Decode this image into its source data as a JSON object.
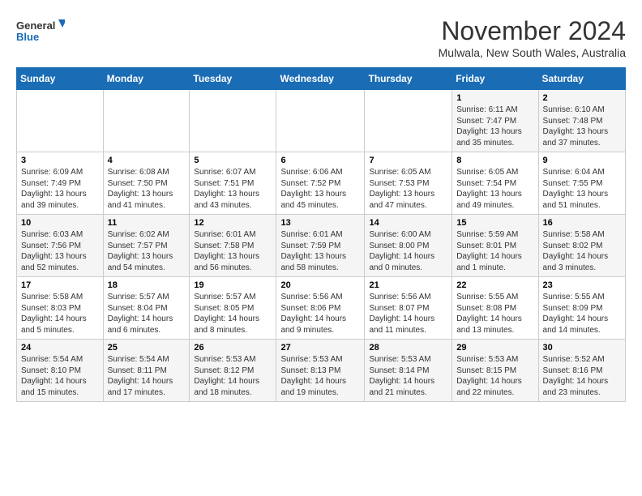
{
  "header": {
    "logo_line1": "General",
    "logo_line2": "Blue",
    "month_title": "November 2024",
    "location": "Mulwala, New South Wales, Australia"
  },
  "days_of_week": [
    "Sunday",
    "Monday",
    "Tuesday",
    "Wednesday",
    "Thursday",
    "Friday",
    "Saturday"
  ],
  "weeks": [
    [
      {
        "day": "",
        "content": ""
      },
      {
        "day": "",
        "content": ""
      },
      {
        "day": "",
        "content": ""
      },
      {
        "day": "",
        "content": ""
      },
      {
        "day": "",
        "content": ""
      },
      {
        "day": "1",
        "content": "Sunrise: 6:11 AM\nSunset: 7:47 PM\nDaylight: 13 hours\nand 35 minutes."
      },
      {
        "day": "2",
        "content": "Sunrise: 6:10 AM\nSunset: 7:48 PM\nDaylight: 13 hours\nand 37 minutes."
      }
    ],
    [
      {
        "day": "3",
        "content": "Sunrise: 6:09 AM\nSunset: 7:49 PM\nDaylight: 13 hours\nand 39 minutes."
      },
      {
        "day": "4",
        "content": "Sunrise: 6:08 AM\nSunset: 7:50 PM\nDaylight: 13 hours\nand 41 minutes."
      },
      {
        "day": "5",
        "content": "Sunrise: 6:07 AM\nSunset: 7:51 PM\nDaylight: 13 hours\nand 43 minutes."
      },
      {
        "day": "6",
        "content": "Sunrise: 6:06 AM\nSunset: 7:52 PM\nDaylight: 13 hours\nand 45 minutes."
      },
      {
        "day": "7",
        "content": "Sunrise: 6:05 AM\nSunset: 7:53 PM\nDaylight: 13 hours\nand 47 minutes."
      },
      {
        "day": "8",
        "content": "Sunrise: 6:05 AM\nSunset: 7:54 PM\nDaylight: 13 hours\nand 49 minutes."
      },
      {
        "day": "9",
        "content": "Sunrise: 6:04 AM\nSunset: 7:55 PM\nDaylight: 13 hours\nand 51 minutes."
      }
    ],
    [
      {
        "day": "10",
        "content": "Sunrise: 6:03 AM\nSunset: 7:56 PM\nDaylight: 13 hours\nand 52 minutes."
      },
      {
        "day": "11",
        "content": "Sunrise: 6:02 AM\nSunset: 7:57 PM\nDaylight: 13 hours\nand 54 minutes."
      },
      {
        "day": "12",
        "content": "Sunrise: 6:01 AM\nSunset: 7:58 PM\nDaylight: 13 hours\nand 56 minutes."
      },
      {
        "day": "13",
        "content": "Sunrise: 6:01 AM\nSunset: 7:59 PM\nDaylight: 13 hours\nand 58 minutes."
      },
      {
        "day": "14",
        "content": "Sunrise: 6:00 AM\nSunset: 8:00 PM\nDaylight: 14 hours\nand 0 minutes."
      },
      {
        "day": "15",
        "content": "Sunrise: 5:59 AM\nSunset: 8:01 PM\nDaylight: 14 hours\nand 1 minute."
      },
      {
        "day": "16",
        "content": "Sunrise: 5:58 AM\nSunset: 8:02 PM\nDaylight: 14 hours\nand 3 minutes."
      }
    ],
    [
      {
        "day": "17",
        "content": "Sunrise: 5:58 AM\nSunset: 8:03 PM\nDaylight: 14 hours\nand 5 minutes."
      },
      {
        "day": "18",
        "content": "Sunrise: 5:57 AM\nSunset: 8:04 PM\nDaylight: 14 hours\nand 6 minutes."
      },
      {
        "day": "19",
        "content": "Sunrise: 5:57 AM\nSunset: 8:05 PM\nDaylight: 14 hours\nand 8 minutes."
      },
      {
        "day": "20",
        "content": "Sunrise: 5:56 AM\nSunset: 8:06 PM\nDaylight: 14 hours\nand 9 minutes."
      },
      {
        "day": "21",
        "content": "Sunrise: 5:56 AM\nSunset: 8:07 PM\nDaylight: 14 hours\nand 11 minutes."
      },
      {
        "day": "22",
        "content": "Sunrise: 5:55 AM\nSunset: 8:08 PM\nDaylight: 14 hours\nand 13 minutes."
      },
      {
        "day": "23",
        "content": "Sunrise: 5:55 AM\nSunset: 8:09 PM\nDaylight: 14 hours\nand 14 minutes."
      }
    ],
    [
      {
        "day": "24",
        "content": "Sunrise: 5:54 AM\nSunset: 8:10 PM\nDaylight: 14 hours\nand 15 minutes."
      },
      {
        "day": "25",
        "content": "Sunrise: 5:54 AM\nSunset: 8:11 PM\nDaylight: 14 hours\nand 17 minutes."
      },
      {
        "day": "26",
        "content": "Sunrise: 5:53 AM\nSunset: 8:12 PM\nDaylight: 14 hours\nand 18 minutes."
      },
      {
        "day": "27",
        "content": "Sunrise: 5:53 AM\nSunset: 8:13 PM\nDaylight: 14 hours\nand 19 minutes."
      },
      {
        "day": "28",
        "content": "Sunrise: 5:53 AM\nSunset: 8:14 PM\nDaylight: 14 hours\nand 21 minutes."
      },
      {
        "day": "29",
        "content": "Sunrise: 5:53 AM\nSunset: 8:15 PM\nDaylight: 14 hours\nand 22 minutes."
      },
      {
        "day": "30",
        "content": "Sunrise: 5:52 AM\nSunset: 8:16 PM\nDaylight: 14 hours\nand 23 minutes."
      }
    ]
  ]
}
